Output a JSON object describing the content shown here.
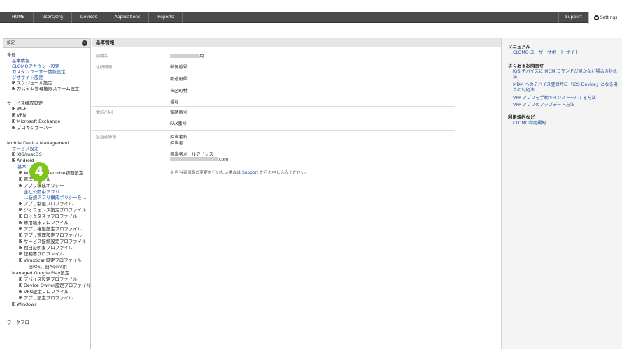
{
  "topnav": {
    "items": [
      "HOME",
      "Users/Org",
      "Devices",
      "Applications",
      "Reports"
    ],
    "support": "Support",
    "settings": "Settings"
  },
  "left": {
    "header": "設定",
    "collapse_icon": "chevron-left-icon",
    "groups": {
      "general": {
        "title": "全般",
        "items": [
          "基本情報",
          "CLOMOアカウント設定",
          "カスタムユーザー情報設定",
          "ジオサイト設定"
        ],
        "expandables": [
          "スケジュール設定",
          "カスタム管理権限スキーム設定"
        ]
      },
      "service": {
        "title": "サービス構成設定",
        "items": [
          "Wi-Fi",
          "VPN",
          "Microsoft Exchange",
          "プロキシサーバー"
        ]
      },
      "mdm": {
        "title": "Mobile Device Management",
        "service_link": "サービス設定",
        "ios": "iOS/macOS",
        "android": "Android",
        "android_basic": "基本",
        "enterprise": "Android Enterprise初期設定…",
        "managed_file": "管理ファイル",
        "app_policy": "アプリ構成ポリシー",
        "public_app": "全社公開中アプリ",
        "new_policy": "…新規アプリ構成ポリシーを…",
        "profiles": [
          "アプリ制限プロファイル",
          "ジオフェンス設定プロファイル",
          "ロックタスクプロファイル",
          "専用端末プロファイル",
          "アプリ権限設定プロファイル",
          "アプリ管理設定プロファイル",
          "サービス接続設定プロファイル",
          "独自証明書プロファイル",
          "証明書プロファイル",
          "VirusScan設定プロファイル"
        ],
        "legacy_sep": "----- 旧iOS、旧Agent用 -----",
        "managed_play": "Managed Google Play設定",
        "play_items": [
          "デバイス設定プロファイル",
          "Device Owner設定プロファイル",
          "VPN設定プロファイル",
          "アプリ設定プロファイル"
        ],
        "windows": "Windows"
      },
      "bottom_partial": "ワークフロー"
    },
    "step_badge": "4"
  },
  "main": {
    "title": "基本情報",
    "org_label": "組織名",
    "org_suffix": "用",
    "address_label": "住所情報",
    "address_fields": [
      "郵便番号",
      "都道府県",
      "市区町村",
      "番地"
    ],
    "phone_label": "電話/FAX",
    "phone_fields": [
      "電話番号",
      "FAX番号"
    ],
    "contact_label": "担当者情報",
    "contact_name_label": "担当者名",
    "contact_name_value": "担当者",
    "contact_email_label": "担当者メールアドレス",
    "contact_email_suffix": ".com",
    "note_prefix": "※ 担当者情報の変更を行いたい場合は ",
    "note_link": "Support",
    "note_suffix": " からお申し込みください。"
  },
  "right": {
    "manual_title": "マニュアル",
    "manual_link": "CLOMO ユーザーサポート サイト",
    "faq_title": "よくあるお問合せ",
    "faq_links": [
      "iOS デバイスに MDM コマンドが届かない場合の対処法",
      "MDM へのデバイス登録時に「iOS Device」となる場合の対処法",
      "VPP アプリを手動でインストールする方法",
      "VPP アプリのアップデート方法"
    ],
    "terms_title": "利用規約など",
    "terms_link": "CLOMO利用規約"
  }
}
